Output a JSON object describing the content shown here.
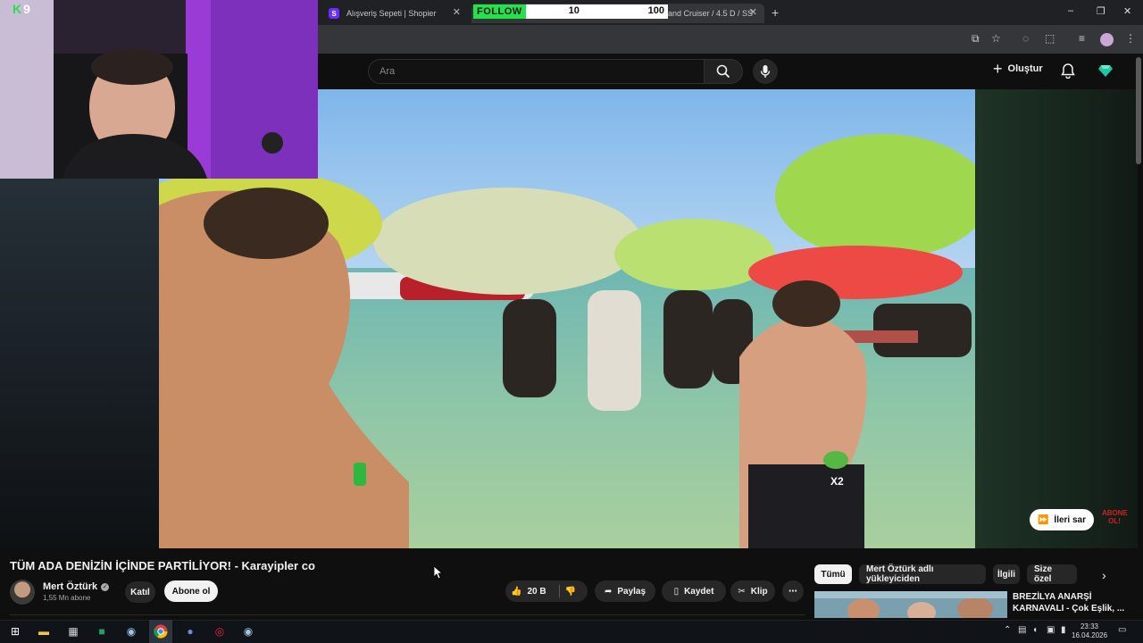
{
  "browser": {
    "tabs": [
      {
        "favicon": "S",
        "title": "Alışveriş Sepeti | Shopier"
      },
      {
        "title": "and Cruiser / 4.5 D / SS"
      }
    ],
    "new_tab": "+",
    "window_controls": {
      "minimize": "–",
      "maximize": "❐",
      "close": "✕"
    }
  },
  "follow_overlay": {
    "label": "FOLLOW",
    "current": "10",
    "goal": "100"
  },
  "stream_logo": {
    "k": "K",
    "num": "9"
  },
  "youtube": {
    "search": {
      "placeholder": "Ara"
    },
    "create_label": "Oluştur",
    "video": {
      "title": "TÜM ADA DENİZİN İÇİNDE PARTİLİYOR! - Karayipler co",
      "skip_label": "İleri sar",
      "sticker_text": "X2",
      "abone_text_1": "ABONE",
      "abone_text_2": "OL!"
    },
    "channel": {
      "name": "Mert Öztürk",
      "subscribers": "1,55 Mn abone",
      "join_label": "Katıl",
      "subscribe_label": "Abone ol"
    },
    "actions": {
      "likes": "20 B",
      "share": "Paylaş",
      "save": "Kaydet",
      "clip": "Klip",
      "more": "⋯"
    },
    "chips": [
      "Tümü",
      "Mert Öztürk adlı yükleyiciden",
      "İlgili",
      "Size özel"
    ],
    "recommendation": {
      "title_line1": "BREZİLYA ANARŞİ",
      "title_line2": "KARNAVALI - Çok Eşlik, ..."
    }
  },
  "taskbar": {
    "time": "23:33",
    "date": "16.04.2026"
  },
  "colors": {
    "follow_green": "#22e34a",
    "yt_bg": "#0f0f0f",
    "chip_active": "#f1f1f1"
  }
}
